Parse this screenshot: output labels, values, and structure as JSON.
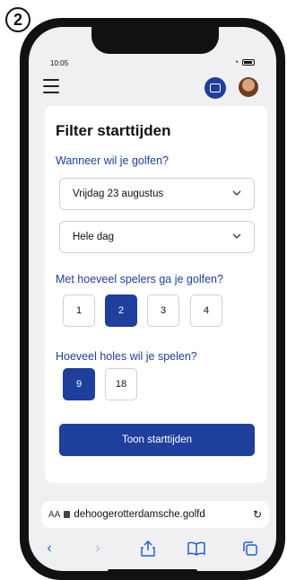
{
  "step_badge": "2",
  "status": {
    "time": "10:05"
  },
  "page": {
    "title": "Filter starttijden",
    "when_question": "Wanneer wil je golfen?",
    "date_select": "Vrijdag 23 augustus",
    "time_select": "Hele dag",
    "players_question": "Met hoeveel spelers ga je golfen?",
    "players_options": [
      "1",
      "2",
      "3",
      "4"
    ],
    "players_selected": "2",
    "holes_question": "Hoeveel holes wil je spelen?",
    "holes_options": [
      "9",
      "18"
    ],
    "holes_selected": "9",
    "submit_label": "Toon starttijden"
  },
  "browser": {
    "aa_label": "AA",
    "url": "dehoogerotterdamsche.golfd"
  },
  "icons": {
    "menu": "hamburger-icon",
    "scan": "scan-icon",
    "back": "chevron-left-icon",
    "forward": "chevron-right-icon",
    "share": "share-icon",
    "bookmarks": "book-icon",
    "tabs": "tabs-icon"
  },
  "colors": {
    "primary": "#1f3f9c",
    "safari_blue": "#1f5fd8"
  }
}
